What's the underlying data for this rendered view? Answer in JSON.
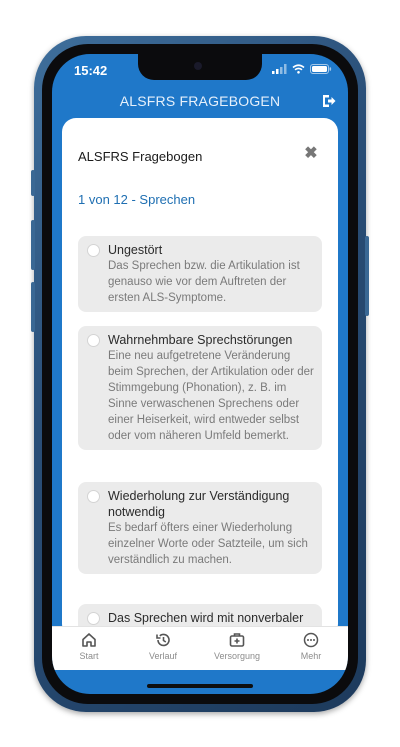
{
  "status_bar": {
    "time": "15:42"
  },
  "header": {
    "title": "ALSFRS FRAGEBOGEN"
  },
  "modal": {
    "title": "ALSFRS Fragebogen",
    "progress": "1 von 12 - Sprechen",
    "options": [
      {
        "title": "Ungestört",
        "description": "Das Sprechen bzw. die Artikulation ist genauso wie vor dem Auftreten der ersten ALS-Symptome."
      },
      {
        "title": "Wahrnehmbare Sprechstörungen",
        "description": "Eine neu aufgetretene Veränderung beim Sprechen, der Artikulation oder der Stimmgebung (Phonation), z. B. im Sinne verwaschenen Sprechens oder einer Heiserkeit, wird entweder selbst oder vom näheren Umfeld bemerkt."
      },
      {
        "title": "Wiederholung zur Verständigung notwendig",
        "description": "Es bedarf öfters einer Wiederholung einzelner Worte oder Satzteile, um sich verständlich zu machen."
      },
      {
        "title": "Das Sprechen wird mit nonverbaler",
        "description": ""
      }
    ]
  },
  "tabbar": {
    "tabs": [
      {
        "label": "Start",
        "icon": "home-icon"
      },
      {
        "label": "Verlauf",
        "icon": "history-icon"
      },
      {
        "label": "Versorgung",
        "icon": "medical-kit-icon"
      },
      {
        "label": "Mehr",
        "icon": "more-icon"
      }
    ]
  },
  "colors": {
    "app_blue": "#1f78c9",
    "progress_text": "#1f6fb2",
    "phone_frame": "#2a4f78"
  }
}
